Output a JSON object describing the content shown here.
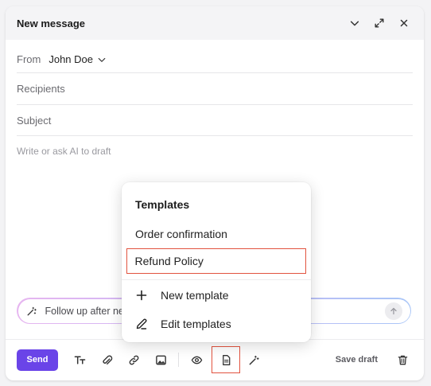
{
  "window": {
    "title": "New message",
    "controls": [
      "chevron-down-icon",
      "expand-icon",
      "close-icon"
    ]
  },
  "from": {
    "label": "From",
    "value": "John Doe"
  },
  "recipients": {
    "placeholder": "Recipients"
  },
  "subject": {
    "placeholder": "Subject"
  },
  "body": {
    "placeholder": "Write or ask AI to draft"
  },
  "ai_prompt": {
    "text": "Follow up after ne"
  },
  "templates_popover": {
    "title": "Templates",
    "items": [
      {
        "label": "Order confirmation"
      },
      {
        "label": "Refund Policy",
        "highlighted": true
      }
    ],
    "actions": [
      {
        "label": "New template",
        "icon": "plus-icon"
      },
      {
        "label": "Edit templates",
        "icon": "pencil-icon"
      }
    ]
  },
  "toolbar": {
    "send_label": "Send",
    "save_draft_label": "Save draft",
    "tools": [
      "text-format-icon",
      "attachment-icon",
      "link-icon",
      "image-icon",
      "preview-eye-icon",
      "template-document-icon",
      "magic-wand-icon",
      "trash-icon"
    ]
  },
  "colors": {
    "accent": "#6a44e8",
    "highlight_border": "#e2533f"
  }
}
